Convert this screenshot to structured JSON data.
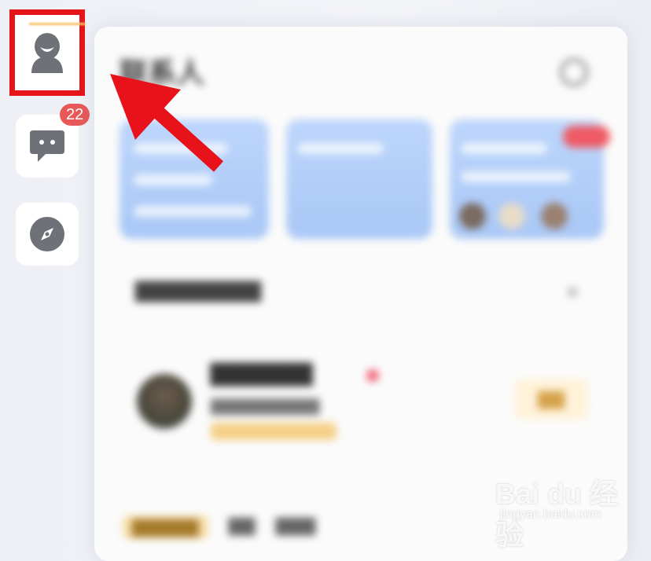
{
  "sidebar": {
    "items": [
      {
        "name": "contacts",
        "icon": "person-icon",
        "highlighted": true
      },
      {
        "name": "messages",
        "icon": "chat-bubble-icon",
        "badge": "22"
      },
      {
        "name": "discover",
        "icon": "compass-icon"
      }
    ]
  },
  "colors": {
    "highlight_box": "#e5151a",
    "badge": "#e85858",
    "icon": "#6f7178",
    "card_blue": "#b3cdf8",
    "arrow": "#e8121a"
  },
  "panel": {
    "title": "联系人",
    "title_legible": false,
    "content_blurred": true
  },
  "watermark": {
    "brand": "Bai du 经验",
    "site": "jingyan.baidu.com"
  }
}
